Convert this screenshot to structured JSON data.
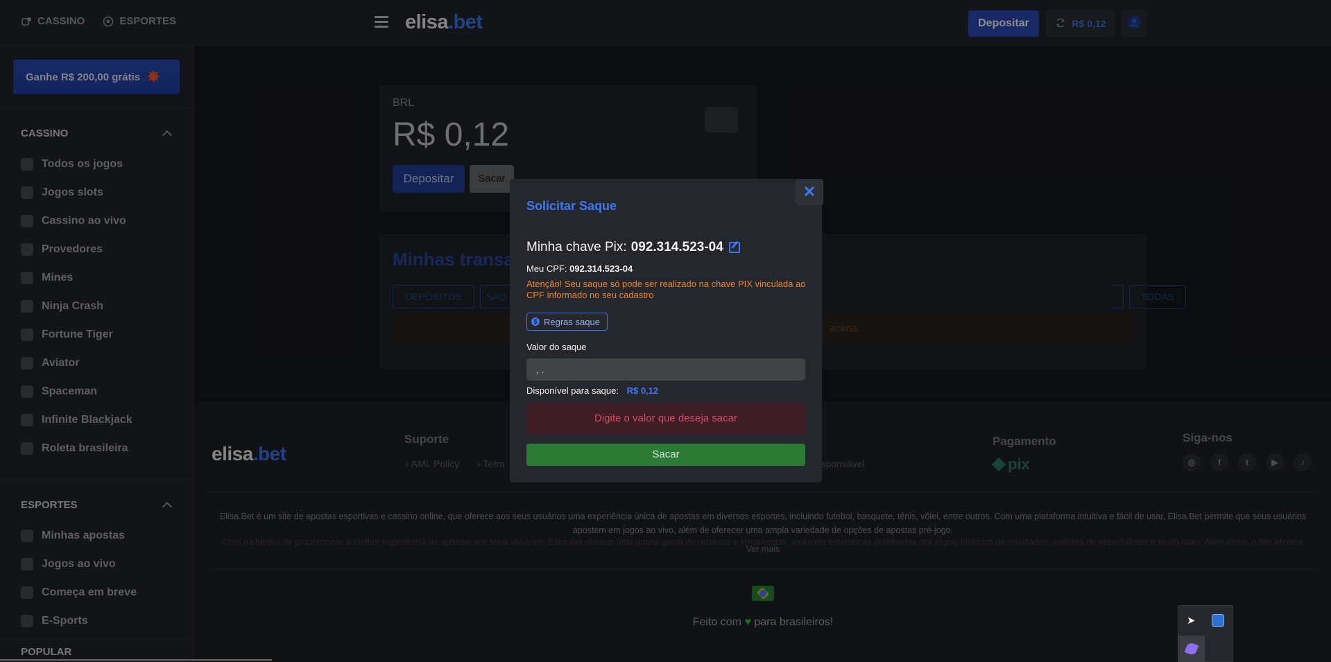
{
  "topbar": {
    "nav": [
      {
        "label": "CASSINO",
        "icon": "casino-icon"
      },
      {
        "label": "ESPORTES",
        "icon": "soccer-ball-icon"
      }
    ],
    "logo": {
      "part1": "elisa",
      "part2": ".bet"
    },
    "deposit_label": "Depositar",
    "balance": "R$ 0,12"
  },
  "sidebar": {
    "promo": "Ganhe R$ 200,00 grátis",
    "casino_title": "CASSINO",
    "casino_items": [
      {
        "label": "Todos os jogos",
        "icon": "crown-icon"
      },
      {
        "label": "Jogos slots",
        "icon": "slots-icon"
      },
      {
        "label": "Cassino ao vivo",
        "icon": "live-cards-icon"
      },
      {
        "label": "Provedores",
        "icon": "provider-icon"
      },
      {
        "label": "Mines",
        "icon": "bomb-icon"
      },
      {
        "label": "Ninja Crash",
        "icon": "ninja-icon"
      },
      {
        "label": "Fortune Tiger",
        "icon": "paw-icon"
      },
      {
        "label": "Aviator",
        "icon": "airplane-icon"
      },
      {
        "label": "Spaceman",
        "icon": "rocket-icon"
      },
      {
        "label": "Infinite Blackjack",
        "icon": "card-icon"
      },
      {
        "label": "Roleta brasileira",
        "icon": "roulette-icon"
      }
    ],
    "sports_title": "ESPORTES",
    "sports_items": [
      {
        "label": "Minhas apostas",
        "icon": "ticket-icon"
      },
      {
        "label": "Jogos ao vivo",
        "icon": "live-video-icon"
      },
      {
        "label": "Começa em breve",
        "icon": "clock-icon"
      },
      {
        "label": "E-Sports",
        "icon": "gamepad-icon"
      }
    ],
    "popular_title": "POPULAR"
  },
  "wallet": {
    "currency": "BRL",
    "amount": "R$ 0,12",
    "deposit_label": "Depositar",
    "withdraw_label": "Sacar"
  },
  "transactions": {
    "title": "Minhas transa",
    "tabs": [
      "DEPÓSITOS",
      "SAQ",
      "",
      "TODAS"
    ],
    "notice": "acima."
  },
  "footer": {
    "logo": {
      "part1": "elisa",
      "part2": ".bet"
    },
    "support_title": "Suporte",
    "links": [
      "AML Policy",
      "Term",
      "responsável"
    ],
    "payment_title": "Pagamento",
    "payment_logo": "pix",
    "social_title": "Siga-nos",
    "about": "Elisa.Bet é um site de apostas esportivas e cassino online, que oferece aos seus usuários uma experiência única de apostas em diversos esportes, incluindo futebol, basquete, tênis, vôlei, entre outros. Com uma plataforma intuitiva e fácil de usar, Elisa.Bet permite que seus usuários apostem em jogos ao vivo, além de oferecer uma ampla variedade de opções de apostas pré-jogo.",
    "about_more": "Com o objetivo de proporcionar a melhor experiência de apostas aos seus usuários, Elisa.Bet oferece uma ampla gama de recursos e ferramentas, incluindo estatísticas detalhadas dos jogos, histórico de resultados, análises de especialistas e muito mais. Além disso, o site oferece",
    "see_more": "Ver mais",
    "made_with_1": "Feito com",
    "made_with_2": "para brasileiros!"
  },
  "modal": {
    "title": "Solicitar Saque",
    "pix_label": "Minha chave Pix:",
    "pix_value": "092.314.523-04",
    "cpf_label": "Meu CPF:",
    "cpf_value": "092.314.523-04",
    "warning": "Atenção! Seu saque só pode ser realizado na chave PIX vinculada ao CPF informado no seu cadastro",
    "rules_label": "Regras saque",
    "amount_label": "Valor do saque",
    "amount_value": ", .",
    "available_label": "Disponível para saque:",
    "available_value": "R$ 0,12",
    "error": "Digite o valor que deseja sacar",
    "submit_label": "Sacar",
    "close_symbol": "✕"
  }
}
